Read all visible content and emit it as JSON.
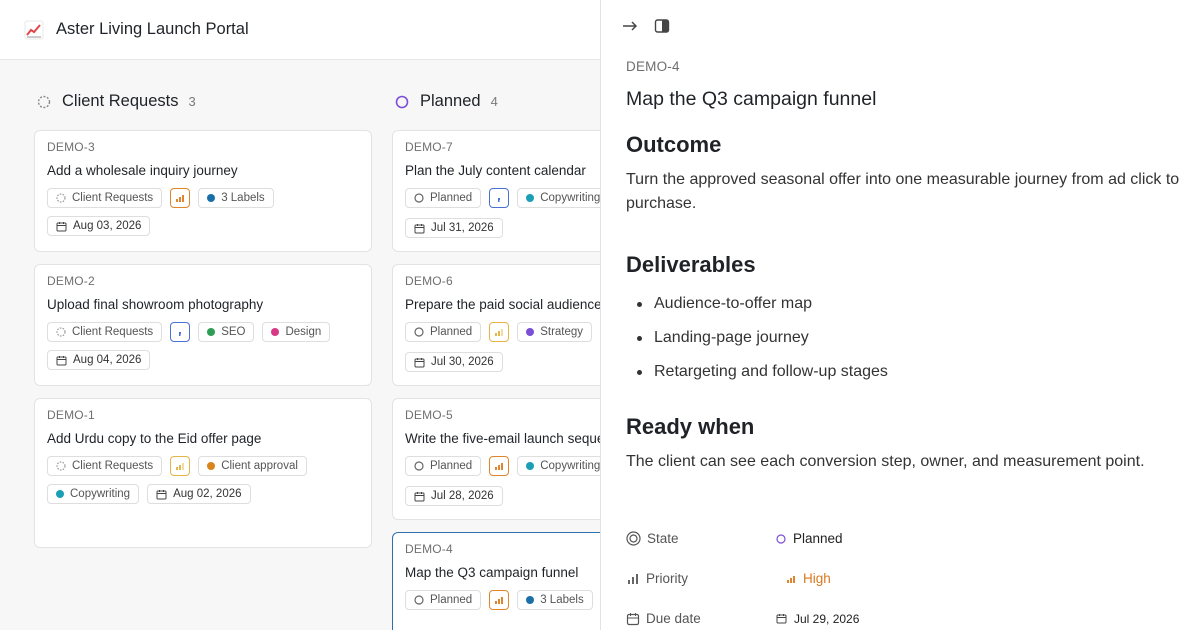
{
  "app": {
    "title": "Aster Living Launch Portal",
    "logo_icon": "chart-increasing-icon"
  },
  "columns": [
    {
      "title": "Client Requests",
      "count": "3",
      "cards": [
        {
          "id": "DEMO-3",
          "title": "Add a wholesale inquiry journey",
          "status": "Client Requests",
          "labels": [
            {
              "name": "3 Labels",
              "color": "#1b6fa8"
            }
          ],
          "due": "Aug 03, 2026"
        },
        {
          "id": "DEMO-2",
          "title": "Upload final showroom photography",
          "status": "Client Requests",
          "labels": [
            {
              "name": "SEO",
              "color": "#2e9e55"
            },
            {
              "name": "Design",
              "color": "#d63a86"
            }
          ],
          "due": "Aug 04, 2026"
        },
        {
          "id": "DEMO-1",
          "title": "Add Urdu copy to the Eid offer page",
          "status": "Client Requests",
          "labels": [
            {
              "name": "Client approval",
              "color": "#d9851c"
            },
            {
              "name": "Copywriting",
              "color": "#1b9fb5"
            }
          ],
          "due": "Aug 02, 2026"
        }
      ]
    },
    {
      "title": "Planned",
      "count": "4",
      "cards": [
        {
          "id": "DEMO-7",
          "title": "Plan the July content calendar",
          "status": "Planned",
          "labels": [
            {
              "name": "Copywriting",
              "color": "#1b9fb5"
            }
          ],
          "due": "Jul 31, 2026"
        },
        {
          "id": "DEMO-6",
          "title": "Prepare the paid social audience",
          "status": "Planned",
          "labels": [
            {
              "name": "Strategy",
              "color": "#7b4fd6"
            }
          ],
          "due": "Jul 30, 2026"
        },
        {
          "id": "DEMO-5",
          "title": "Write the five-email launch sequence",
          "status": "Planned",
          "labels": [
            {
              "name": "Copywriting",
              "color": "#1b9fb5"
            }
          ],
          "due": "Jul 28, 2026"
        },
        {
          "id": "DEMO-4",
          "title": "Map the Q3 campaign funnel",
          "status": "Planned",
          "labels": [
            {
              "name": "3 Labels",
              "color": "#1b6fa8"
            }
          ],
          "due": ""
        }
      ]
    }
  ],
  "detail": {
    "id": "DEMO-4",
    "title": "Map the Q3 campaign funnel",
    "outcome_heading": "Outcome",
    "outcome_text": "Turn the approved seasonal offer into one measurable journey from ad click to purchase.",
    "deliverables_heading": "Deliverables",
    "deliverables": [
      "Audience-to-offer map",
      "Landing-page journey",
      "Retargeting and follow-up stages"
    ],
    "ready_heading": "Ready when",
    "ready_text": "The client can see each conversion step, owner, and measurement point.",
    "properties": {
      "state_label": "State",
      "state_value": "Planned",
      "priority_label": "Priority",
      "priority_value": "High",
      "due_label": "Due date",
      "due_value": "Jul 29, 2026"
    }
  },
  "colors": {
    "accent": "#2f6fad",
    "high_priority": "#d97820",
    "planned": "#7b4fd6"
  }
}
